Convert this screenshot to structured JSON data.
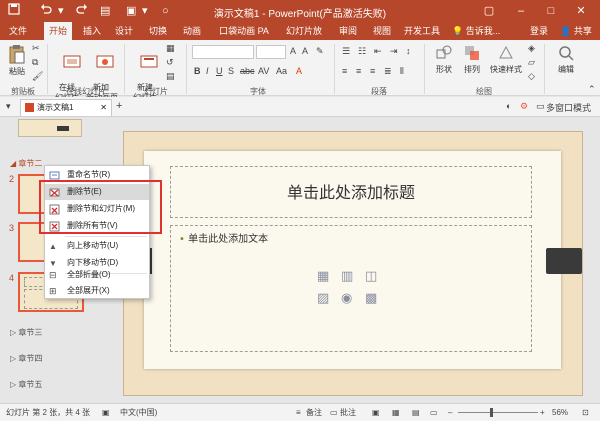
{
  "titlebar": {
    "title": "演示文稿1 - PowerPoint(产品激活失败)",
    "save_icon": "save-icon",
    "undo_icon": "undo-icon",
    "redo_icon": "redo-icon"
  },
  "tabs": [
    {
      "label": "文件"
    },
    {
      "label": "开始"
    },
    {
      "label": "插入"
    },
    {
      "label": "设计"
    },
    {
      "label": "切换"
    },
    {
      "label": "动画"
    },
    {
      "label": "口袋动画 PA"
    },
    {
      "label": "幻灯片放映"
    },
    {
      "label": "审阅"
    },
    {
      "label": "视图"
    },
    {
      "label": "开发工具"
    }
  ],
  "tell_me": "告诉我...",
  "login": "登录",
  "share": "共享",
  "ribbon": {
    "paste": "粘贴",
    "online_slides": "在线\n幻灯片",
    "new_slide_page": "新加\n新动画页",
    "new_slide": "新建\n幻灯片",
    "shapes": "形状",
    "arrange": "排列",
    "quick_styles": "快速样式",
    "editing": "编辑",
    "groups": {
      "clipboard": "剪贴板",
      "online": "在线幻灯片",
      "slides": "幻灯片",
      "font": "字体",
      "paragraph": "段落",
      "drawing": "绘图"
    }
  },
  "doc_tab": "演示文稿1",
  "multi_window": "多窗口模式",
  "left_pane": {
    "sections": [
      "章节二",
      "章节三",
      "章节四",
      "章节五"
    ],
    "slide_numbers": [
      "2",
      "3",
      "4"
    ]
  },
  "context_menu": {
    "items": [
      {
        "label": "重命名节(R)"
      },
      {
        "label": "删除节(E)"
      },
      {
        "label": "删除节和幻灯片(M)"
      },
      {
        "label": "删除所有节(V)"
      },
      {
        "label": "向上移动节(U)"
      },
      {
        "label": "向下移动节(D)"
      },
      {
        "label": "全部折叠(O)"
      },
      {
        "label": "全部展开(X)"
      }
    ]
  },
  "slide": {
    "title_placeholder": "单击此处添加标题",
    "body_placeholder": "单击此处添加文本"
  },
  "statusbar": {
    "slide_info": "幻灯片 第 2 张，共 4 张",
    "language": "中文(中国)",
    "notes": "备注",
    "comments": "批注",
    "zoom": "56%"
  },
  "colors": {
    "accent": "#b7472a",
    "highlight_box": "#e0302f"
  }
}
